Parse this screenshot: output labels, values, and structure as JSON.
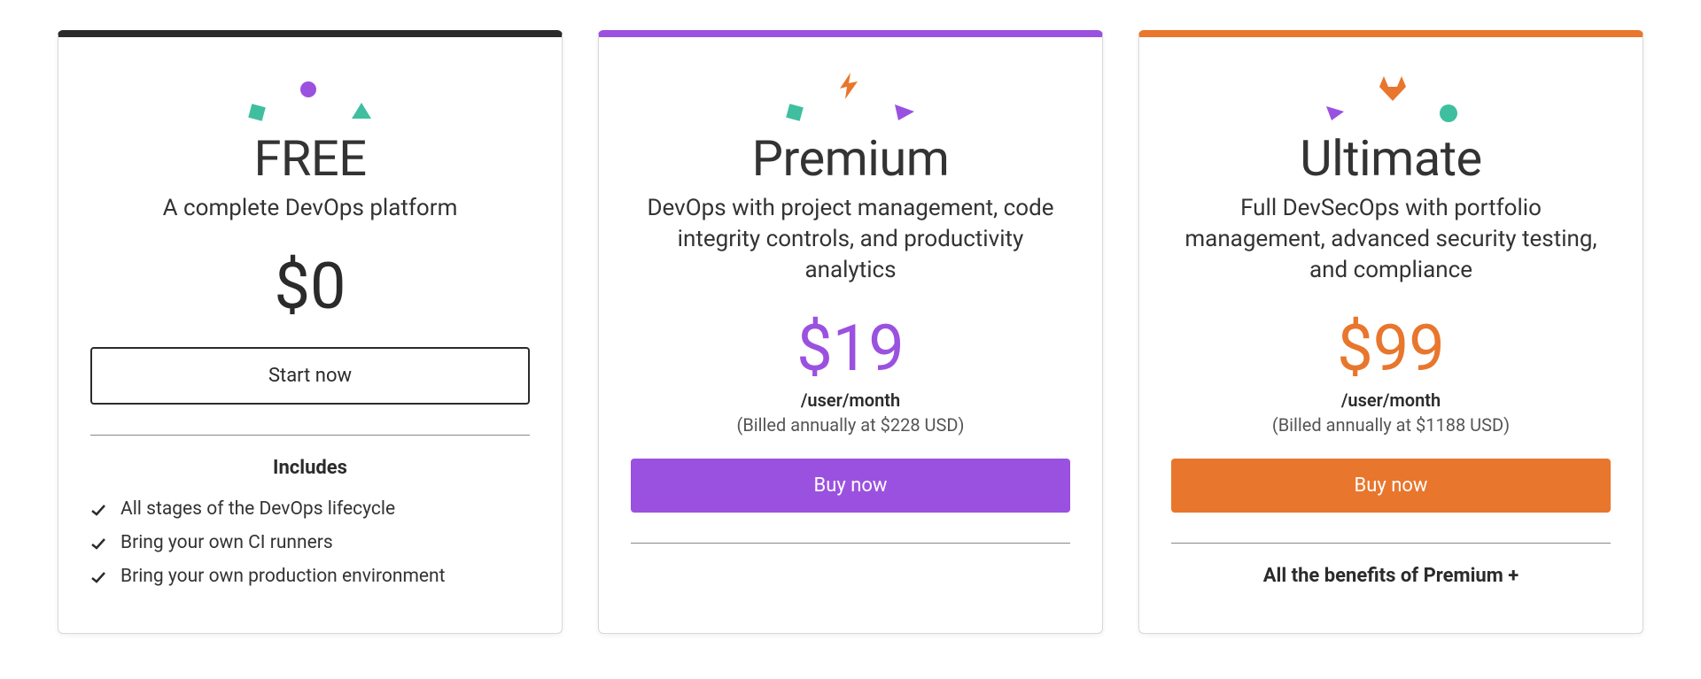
{
  "colors": {
    "free": "#2b2b2b",
    "premium": "#9b51e0",
    "ultimate": "#e8762c",
    "teal": "#3fbf9f"
  },
  "tiers": {
    "free": {
      "name": "FREE",
      "description": "A complete DevOps platform",
      "price": "$0",
      "cta": "Start now",
      "includes_label": "Includes",
      "features": [
        "All stages of the DevOps lifecycle",
        "Bring your own CI runners",
        "Bring your own production environment"
      ]
    },
    "premium": {
      "name": "Premium",
      "description": "DevOps with project management, code integrity controls, and productivity analytics",
      "price": "$19",
      "price_unit": "/user/month",
      "price_note": "(Billed annually at $228 USD)",
      "cta": "Buy now"
    },
    "ultimate": {
      "name": "Ultimate",
      "description": "Full DevSecOps with portfolio management, advanced security testing, and compliance",
      "price": "$99",
      "price_unit": "/user/month",
      "price_note": "(Billed annually at $1188 USD)",
      "cta": "Buy now",
      "includes_label": "All the benefits of Premium +"
    }
  }
}
